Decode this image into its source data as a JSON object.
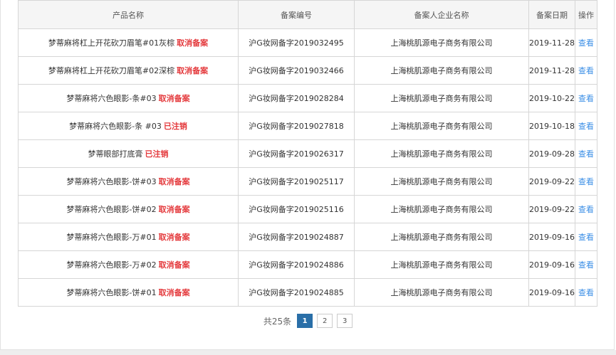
{
  "table": {
    "headers": [
      "产品名称",
      "备案编号",
      "备案人企业名称",
      "备案日期",
      "操作"
    ],
    "rows": [
      {
        "name": "梦蒂麻将杠上开花砍刀眉笔#01灰棕",
        "status": "取消备案",
        "code": "沪G妆网备字2019032495",
        "company": "上海桃肌源电子商务有限公司",
        "date": "2019-11-28",
        "action": "查看"
      },
      {
        "name": "梦蒂麻将杠上开花砍刀眉笔#02深棕",
        "status": "取消备案",
        "code": "沪G妆网备字2019032466",
        "company": "上海桃肌源电子商务有限公司",
        "date": "2019-11-28",
        "action": "查看"
      },
      {
        "name": "梦蒂麻将六色眼影-条#03",
        "status": "取消备案",
        "code": "沪G妆网备字2019028284",
        "company": "上海桃肌源电子商务有限公司",
        "date": "2019-10-22",
        "action": "查看"
      },
      {
        "name": "梦蒂麻将六色眼影-条 #03",
        "status": "已注销",
        "code": "沪G妆网备字2019027818",
        "company": "上海桃肌源电子商务有限公司",
        "date": "2019-10-18",
        "action": "查看"
      },
      {
        "name": "梦蒂眼部打底膏",
        "status": "已注销",
        "code": "沪G妆网备字2019026317",
        "company": "上海桃肌源电子商务有限公司",
        "date": "2019-09-28",
        "action": "查看"
      },
      {
        "name": "梦蒂麻将六色眼影-饼#03",
        "status": "取消备案",
        "code": "沪G妆网备字2019025117",
        "company": "上海桃肌源电子商务有限公司",
        "date": "2019-09-22",
        "action": "查看"
      },
      {
        "name": "梦蒂麻将六色眼影-饼#02",
        "status": "取消备案",
        "code": "沪G妆网备字2019025116",
        "company": "上海桃肌源电子商务有限公司",
        "date": "2019-09-22",
        "action": "查看"
      },
      {
        "name": "梦蒂麻将六色眼影-万#01",
        "status": "取消备案",
        "code": "沪G妆网备字2019024887",
        "company": "上海桃肌源电子商务有限公司",
        "date": "2019-09-16",
        "action": "查看"
      },
      {
        "name": "梦蒂麻将六色眼影-万#02",
        "status": "取消备案",
        "code": "沪G妆网备字2019024886",
        "company": "上海桃肌源电子商务有限公司",
        "date": "2019-09-16",
        "action": "查看"
      },
      {
        "name": "梦蒂麻将六色眼影-饼#01",
        "status": "取消备案",
        "code": "沪G妆网备字2019024885",
        "company": "上海桃肌源电子商务有限公司",
        "date": "2019-09-16",
        "action": "查看"
      }
    ]
  },
  "pagination": {
    "total": "共25条",
    "pages": [
      "1",
      "2",
      "3"
    ],
    "current": "1"
  },
  "colors": {
    "status": "#e4393c",
    "link": "#3a8ee6",
    "active_page": "#2a6fa8"
  }
}
